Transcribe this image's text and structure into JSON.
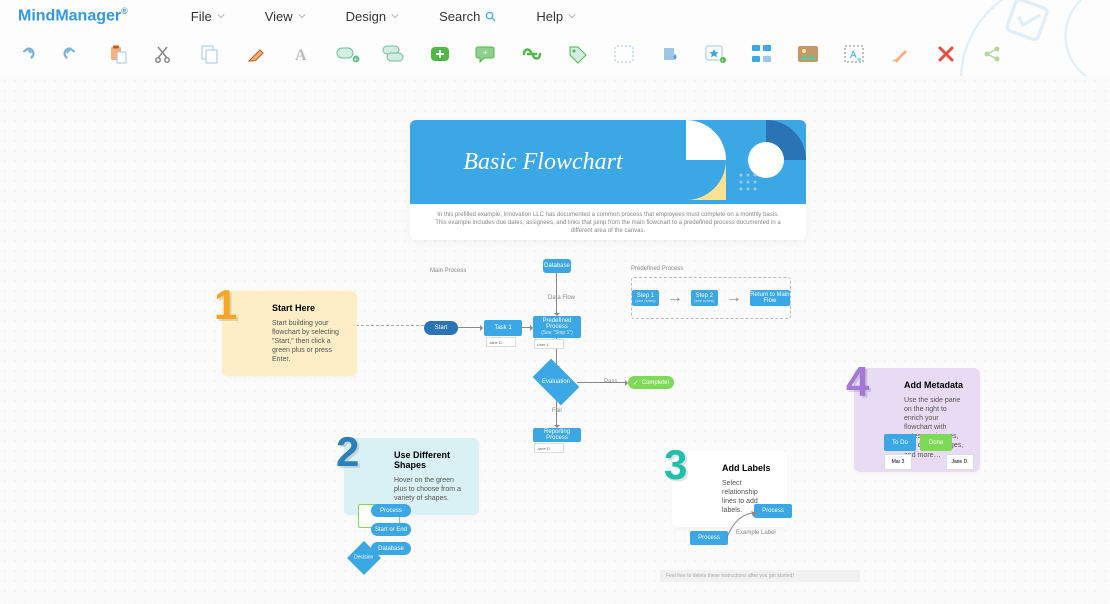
{
  "app": {
    "name": "MindManager",
    "reg": "®"
  },
  "menu": {
    "file": "File",
    "view": "View",
    "design": "Design",
    "search": "Search",
    "help": "Help"
  },
  "toolbar_icons": [
    "undo-icon",
    "redo-icon",
    "paste-icon",
    "cut-icon",
    "copy-icon",
    "highlight-icon",
    "font-icon",
    "note-icon",
    "label-icon",
    "add-green-icon",
    "callout-icon",
    "link-icon",
    "tag-icon",
    "boundary-icon",
    "fill-icon",
    "star-icon",
    "relationship-icon",
    "image-icon",
    "select-area-icon",
    "marker-icon",
    "delete-icon",
    "share-icon"
  ],
  "title": {
    "main": "Basic Flowchart",
    "desc": "In this prefilled example, Innovation LLC has documented a common process that employees must complete on a monthly basis. This example includes due dates, assignees, and links that jump from the main flowchart to a predefined process documented in a different area of the canvas."
  },
  "sections": {
    "main_process": "Main Process",
    "predefined_process": "Predefined Process",
    "data_flow": "Data Flow"
  },
  "callouts": {
    "c1": {
      "title": "Start Here",
      "body": "Start building your flowchart by selecting \"Start,\" then click a green plus or press Enter."
    },
    "c2": {
      "title": "Use Different Shapes",
      "body": "Hover on the green plus to choose from a variety of shapes."
    },
    "c3": {
      "title": "Add Labels",
      "body": "Select relationship lines to add labels."
    },
    "c4": {
      "title": "Add Metadata",
      "body": "Use the side pane on the right to enrich your flowchart with notes, assignees, due dates, images, and more…"
    }
  },
  "shapes": {
    "start": "Start",
    "task1": "Task 1",
    "predef": "Predefined Process",
    "predef_sub": "(See \"Step 1\")",
    "database": "Database",
    "evaluation": "Evaluation",
    "reporting": "Reporting Process",
    "complete": "Complete!",
    "pass": "Pass",
    "fail": "Fail",
    "step1": "Step 1",
    "step2": "Step 2",
    "return": "Return to Main Flow",
    "process": "Process",
    "start_end": "Start or End",
    "decision": "Decision",
    "db_label": "Database",
    "example_label": "Example Label",
    "todo": "To Do",
    "done": "Done",
    "see_step1": "(see notes)",
    "user1": "User 1",
    "jane": "Jane D.",
    "mar": "Mar 3"
  },
  "hint": "Feel free to delete these instructions after you get started!",
  "colors": {
    "primary": "#3ba7e5",
    "accent_orange": "#f5a623",
    "accent_teal": "#1fbfa9",
    "accent_purple": "#a577d8",
    "green": "#7ed957"
  }
}
